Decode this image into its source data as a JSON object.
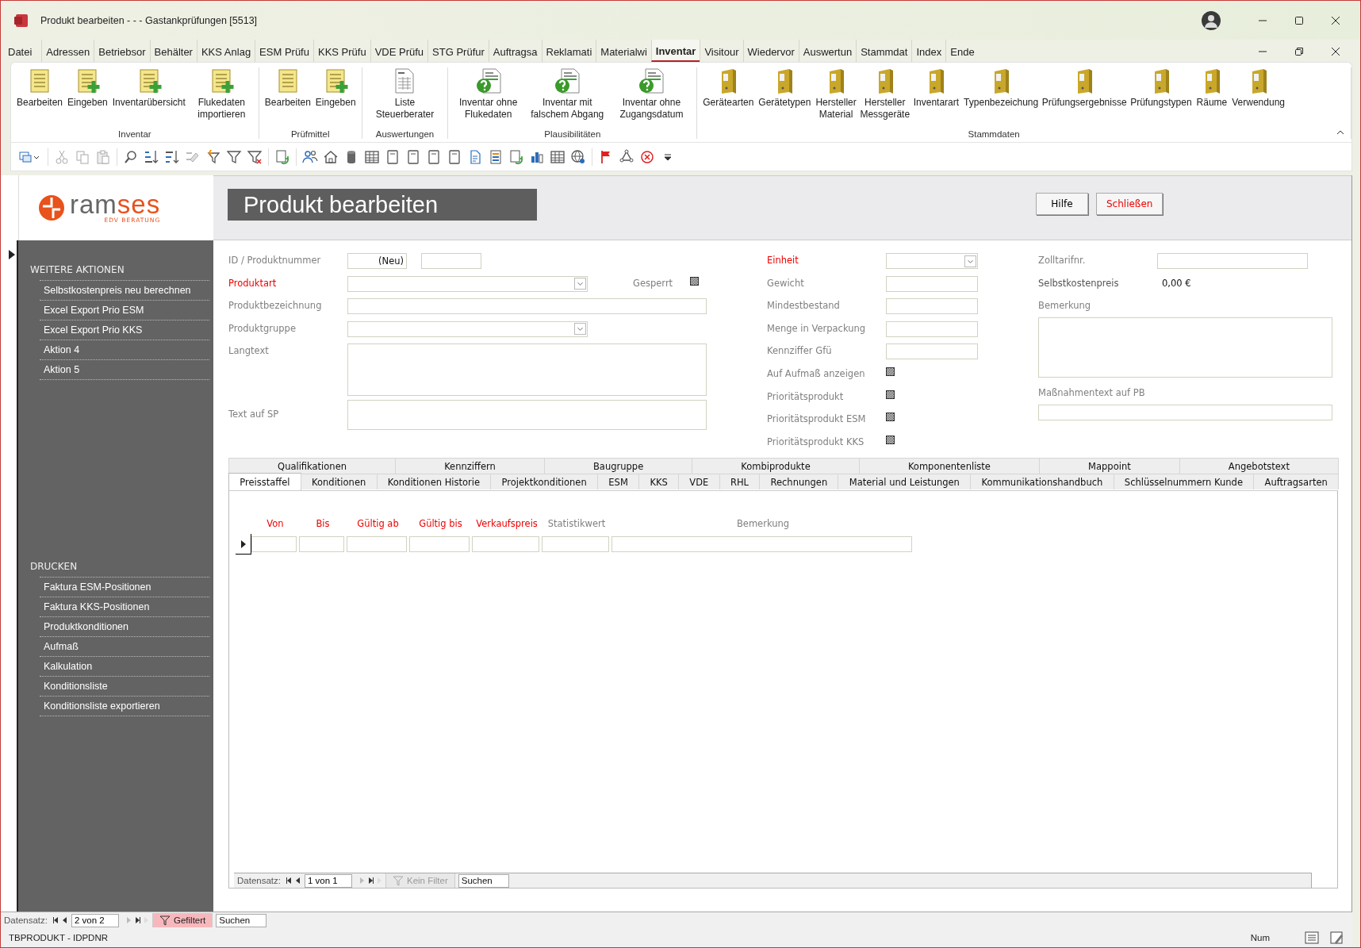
{
  "window": {
    "title": "Produkt bearbeiten -  -  -  Gastankprüfungen [5513]"
  },
  "menu_tabs": [
    {
      "label": "Datei",
      "selected": false
    },
    {
      "label": "Adressen",
      "selected": false
    },
    {
      "label": "Betriebsor",
      "selected": false
    },
    {
      "label": "Behälter",
      "selected": false
    },
    {
      "label": "KKS Anlag",
      "selected": false
    },
    {
      "label": "ESM Prüfu",
      "selected": false
    },
    {
      "label": "KKS Prüfu",
      "selected": false
    },
    {
      "label": "VDE Prüfu",
      "selected": false
    },
    {
      "label": "STG Prüfur",
      "selected": false
    },
    {
      "label": "Auftragsa",
      "selected": false
    },
    {
      "label": "Reklamati",
      "selected": false
    },
    {
      "label": "Materialwi",
      "selected": false
    },
    {
      "label": "Inventar",
      "selected": true
    },
    {
      "label": "Visitour",
      "selected": false
    },
    {
      "label": "Wiedervor",
      "selected": false
    },
    {
      "label": "Auswertun",
      "selected": false
    },
    {
      "label": "Stammdat",
      "selected": false
    },
    {
      "label": "Index",
      "selected": false
    },
    {
      "label": "Ende",
      "selected": false
    }
  ],
  "ribbon_groups": [
    {
      "label": "Inventar",
      "buttons": [
        {
          "label": "Bearbeiten",
          "kind": "list"
        },
        {
          "label": "Eingeben",
          "kind": "list-add"
        },
        {
          "label": "Inventarübersicht",
          "kind": "list-add"
        },
        {
          "label": "Flukedaten importieren",
          "kind": "list-add"
        }
      ]
    },
    {
      "label": "Prüfmittel",
      "buttons": [
        {
          "label": "Bearbeiten",
          "kind": "list"
        },
        {
          "label": "Eingeben",
          "kind": "list-add"
        }
      ]
    },
    {
      "label": "Auswertungen",
      "buttons": [
        {
          "label": "Liste Steuerberater",
          "kind": "report"
        }
      ]
    },
    {
      "label": "Plausibilitäten",
      "buttons": [
        {
          "label": "Inventar ohne Flukedaten",
          "kind": "question"
        },
        {
          "label": "Inventar mit falschem Abgang",
          "kind": "question"
        },
        {
          "label": "Inventar ohne Zugangsdatum",
          "kind": "question"
        }
      ]
    },
    {
      "label": "Stammdaten",
      "buttons": [
        {
          "label": "Gerätearten",
          "kind": "binder"
        },
        {
          "label": "Gerätetypen",
          "kind": "binder"
        },
        {
          "label": "Hersteller Material",
          "kind": "binder"
        },
        {
          "label": "Hersteller Messgeräte",
          "kind": "binder"
        },
        {
          "label": "Inventarart",
          "kind": "binder"
        },
        {
          "label": "Typenbezeichung",
          "kind": "binder"
        },
        {
          "label": "Prüfungsergebnisse",
          "kind": "binder"
        },
        {
          "label": "Prüfungstypen",
          "kind": "binder"
        },
        {
          "label": "Räume",
          "kind": "binder"
        },
        {
          "label": "Verwendung",
          "kind": "binder"
        }
      ]
    }
  ],
  "form": {
    "title": "Produkt bearbeiten",
    "logo": {
      "part_1": "ram",
      "part_2": "ses",
      "tagline": "EDV BERATUNG"
    },
    "buttons": [
      {
        "label": "Hilfe",
        "kind": "normal"
      },
      {
        "label": "Schließen",
        "kind": "danger"
      }
    ]
  },
  "sidebar": {
    "sections": [
      {
        "heading": "WEITERE AKTIONEN",
        "items": [
          "Selbstkostenpreis neu berechnen",
          "Excel Export Prio ESM",
          "Excel Export Prio KKS",
          "Aktion 4",
          "Aktion 5"
        ]
      },
      {
        "heading": "DRUCKEN",
        "items": [
          "Faktura ESM-Positionen",
          "Faktura KKS-Positionen",
          "Produktkonditionen",
          "Aufmaß",
          "Kalkulation",
          "Konditionsliste",
          "Konditionsliste exportieren"
        ]
      }
    ]
  },
  "fields": {
    "column_1": [
      {
        "kind": "id",
        "label": "ID / Produktnummer",
        "required": false,
        "value": "(Neu)"
      },
      {
        "kind": "combo",
        "label": "Produktart",
        "required": true,
        "checkbox": {
          "label": "Gesperrt",
          "indeterminate": true
        }
      },
      {
        "kind": "text",
        "label": "Produktbezeichnung",
        "required": false
      },
      {
        "kind": "combo",
        "label": "Produktgruppe",
        "required": false
      },
      {
        "kind": "memo",
        "label": "Langtext",
        "required": false
      },
      {
        "kind": "memo-small",
        "label": "Text auf SP",
        "required": false
      }
    ],
    "column_2": [
      {
        "kind": "combo",
        "label": "Einheit",
        "required": true
      },
      {
        "kind": "text",
        "label": "Gewicht",
        "required": false
      },
      {
        "kind": "text",
        "label": "Mindestbestand",
        "required": false
      },
      {
        "kind": "text",
        "label": "Menge in Verpackung",
        "required": false
      },
      {
        "kind": "text",
        "label": "Kennziffer Gfü",
        "required": false
      },
      {
        "kind": "checkbox",
        "label": "Auf Aufmaß anzeigen",
        "required": false,
        "indeterminate": true
      },
      {
        "kind": "checkbox",
        "label": "Prioritätsprodukt",
        "required": false,
        "indeterminate": true
      },
      {
        "kind": "checkbox",
        "label": "Prioritätsprodukt ESM",
        "required": false,
        "indeterminate": true
      },
      {
        "kind": "checkbox",
        "label": "Prioritätsprodukt KKS",
        "required": false,
        "indeterminate": true
      }
    ],
    "column_3": [
      {
        "kind": "text",
        "label": "Zolltarifnr.",
        "required": false
      },
      {
        "kind": "value",
        "label": "Selbstkostenpreis",
        "required": false,
        "value": "0,00 €"
      },
      {
        "kind": "memo-below",
        "label": "Bemerkung",
        "required": false
      },
      {
        "kind": "text-below",
        "label": "Maßnahmentext auf PB",
        "required": false
      }
    ]
  },
  "subform_tabs": [
    [
      {
        "label": "Qualifikationen",
        "selected": false
      },
      {
        "label": "Kennziffern",
        "selected": false
      },
      {
        "label": "Baugruppe",
        "selected": false
      },
      {
        "label": "Kombiprodukte",
        "selected": false
      },
      {
        "label": "Komponentenliste",
        "selected": false
      },
      {
        "label": "Mappoint",
        "selected": false
      },
      {
        "label": "Angebotstext",
        "selected": false
      }
    ],
    [
      {
        "label": "Preisstaffel",
        "selected": true
      },
      {
        "label": "Konditionen",
        "selected": false
      },
      {
        "label": "Konditionen Historie",
        "selected": false
      },
      {
        "label": "Projektkonditionen",
        "selected": false
      },
      {
        "label": "ESM",
        "selected": false
      },
      {
        "label": "KKS",
        "selected": false
      },
      {
        "label": "VDE",
        "selected": false
      },
      {
        "label": "RHL",
        "selected": false
      },
      {
        "label": "Rechnungen",
        "selected": false
      },
      {
        "label": "Material und Leistungen",
        "selected": false
      },
      {
        "label": "Kommunikationshandbuch",
        "selected": false
      },
      {
        "label": "Schlüsselnummern Kunde",
        "selected": false
      },
      {
        "label": "Auftragsarten",
        "selected": false
      }
    ]
  ],
  "price_table": {
    "columns": [
      {
        "label": "Von",
        "required": true
      },
      {
        "label": "Bis",
        "required": true
      },
      {
        "label": "Gültig ab",
        "required": true
      },
      {
        "label": "Gültig bis",
        "required": true
      },
      {
        "label": "Verkaufspreis",
        "required": true
      },
      {
        "label": "Statistikwert",
        "required": false
      },
      {
        "label": "Bemerkung",
        "required": false
      }
    ]
  },
  "subform_nav": {
    "label": "Datensatz:",
    "position": "1 von 1",
    "filter": {
      "label": "Kein Filter",
      "filtered": false
    },
    "search": {
      "placeholder": "Suchen"
    }
  },
  "form_nav": {
    "label": "Datensatz:",
    "position": "2 von 2",
    "filter": {
      "label": "Gefiltert",
      "filtered": true
    },
    "search": {
      "placeholder": "Suchen"
    }
  },
  "status_bar": {
    "text": "TBPRODUKT - IDPDNR",
    "indicator": "Num"
  }
}
